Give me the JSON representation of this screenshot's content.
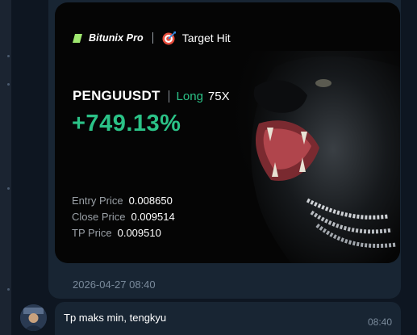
{
  "card": {
    "brand": "Bitunix Pro",
    "badge": "Target Hit",
    "pair": "PENGUUSDT",
    "side": "Long",
    "leverage": "75X",
    "pnl": "+749.13%",
    "prices": [
      {
        "label": "Entry Price",
        "value": "0.008650"
      },
      {
        "label": "Close Price",
        "value": "0.009514"
      },
      {
        "label": "TP Price",
        "value": "0.009510"
      }
    ]
  },
  "timestamp": "2026-04-27 08:40",
  "message": {
    "text": "Tp maks min, tengkyu",
    "time": "08:40"
  },
  "colors": {
    "background": "#0e1621",
    "bubble": "#182533",
    "accent_green": "#2bc287",
    "card": "#050505"
  }
}
